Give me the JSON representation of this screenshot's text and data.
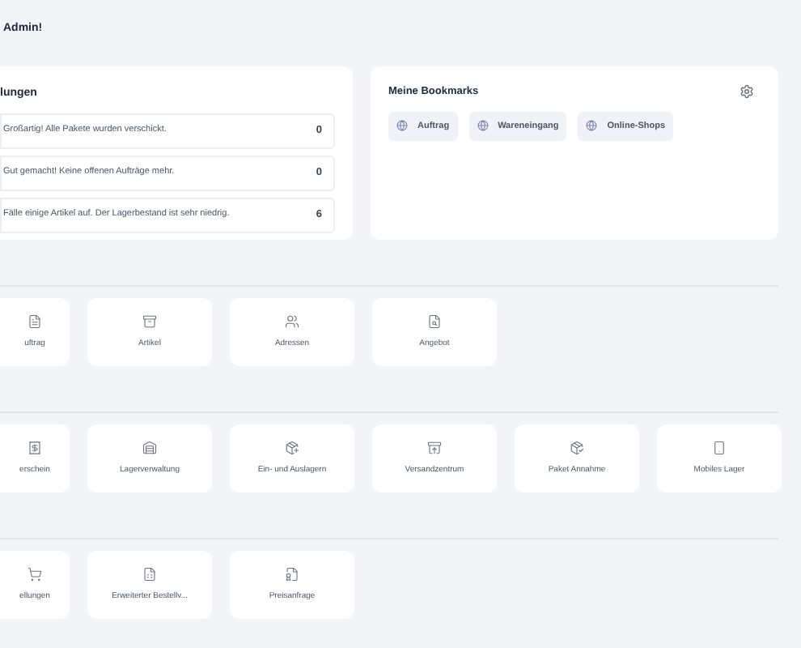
{
  "greeting": "Admin!",
  "notifications": {
    "title": "lungen",
    "items": [
      {
        "text": "Großartig! Alle Pakete wurden verschickt.",
        "count": "0"
      },
      {
        "text": "Gut gemacht! Keine offenen Aufträge mehr.",
        "count": "0"
      },
      {
        "text": "Fälle einige Artikel auf. Der Lagerbestand ist sehr niedrig.",
        "count": "6"
      }
    ]
  },
  "bookmarks": {
    "title": "Meine Bookmarks",
    "items": [
      "Auftrag",
      "Wareneingang",
      "Online-Shops"
    ]
  },
  "sections": [
    {
      "tiles": [
        {
          "label": "uftrag",
          "kind": "order"
        },
        {
          "label": "Artikel",
          "kind": "box"
        },
        {
          "label": "Adressen",
          "kind": "people"
        },
        {
          "label": "Angebot",
          "kind": "offer"
        }
      ]
    },
    {
      "tiles": [
        {
          "label": "erschein",
          "kind": "receipt"
        },
        {
          "label": "Lagerverwaltung",
          "kind": "warehouse"
        },
        {
          "label": "Ein- und Auslagern",
          "kind": "inout"
        },
        {
          "label": "Versandzentrum",
          "kind": "ship"
        },
        {
          "label": "Paket Annahme",
          "kind": "receive"
        },
        {
          "label": "Mobiles Lager",
          "kind": "mobile"
        }
      ]
    },
    {
      "tiles": [
        {
          "label": "ellungen",
          "kind": "cart"
        },
        {
          "label": "Erweiterter Bestellv...",
          "kind": "list"
        },
        {
          "label": "Preisanfrage",
          "kind": "price"
        }
      ]
    }
  ]
}
